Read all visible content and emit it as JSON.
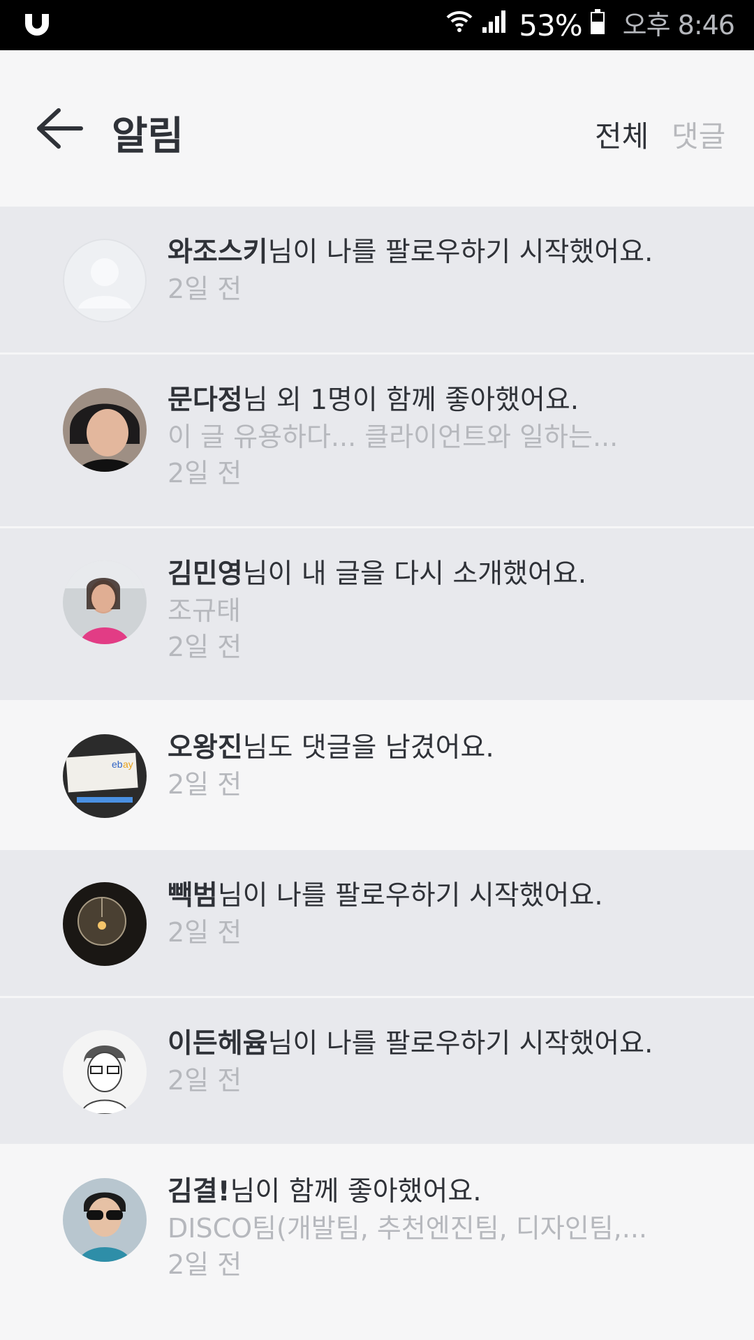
{
  "status_bar": {
    "battery_pct": "53%",
    "time": "오후 8:46",
    "icons": [
      "app-logo-icon",
      "wifi-icon",
      "signal-icon",
      "battery-icon"
    ]
  },
  "header": {
    "title": "알림",
    "tabs": [
      {
        "label": "전체",
        "active": true
      },
      {
        "label": "댓글",
        "active": false
      }
    ]
  },
  "notifications": [
    {
      "name": "와조스키",
      "message": "님이 나를 팔로우하기 시작했어요.",
      "preview": "",
      "time": "2일 전",
      "unread": true,
      "avatar": "default-avatar"
    },
    {
      "name": "문다정",
      "message": "님 외 1명이 함께 좋아했어요.",
      "preview": "이 글 유용하다... 클라이언트와 일하는...",
      "time": "2일 전",
      "unread": true,
      "avatar": "photo-avatar"
    },
    {
      "name": "김민영",
      "message": "님이 내 글을 다시 소개했어요.",
      "preview": "조규태",
      "time": "2일 전",
      "unread": true,
      "avatar": "photo-avatar"
    },
    {
      "name": "오왕진",
      "message": "님도 댓글을 남겼어요.",
      "preview": "",
      "time": "2일 전",
      "unread": false,
      "avatar": "photo-avatar"
    },
    {
      "name": "빽범",
      "message": "님이 나를 팔로우하기 시작했어요.",
      "preview": "",
      "time": "2일 전",
      "unread": true,
      "avatar": "photo-avatar"
    },
    {
      "name": "이든헤윰",
      "message": "님이 나를 팔로우하기 시작했어요.",
      "preview": "",
      "time": "2일 전",
      "unread": true,
      "avatar": "sketch-avatar"
    },
    {
      "name": "김결!",
      "message": "님이 함께 좋아했어요.",
      "preview": "DISCO팀(개발팀, 추천엔진팀, 디자인팀,...",
      "time": "2일 전",
      "unread": false,
      "avatar": "photo-avatar"
    }
  ]
}
